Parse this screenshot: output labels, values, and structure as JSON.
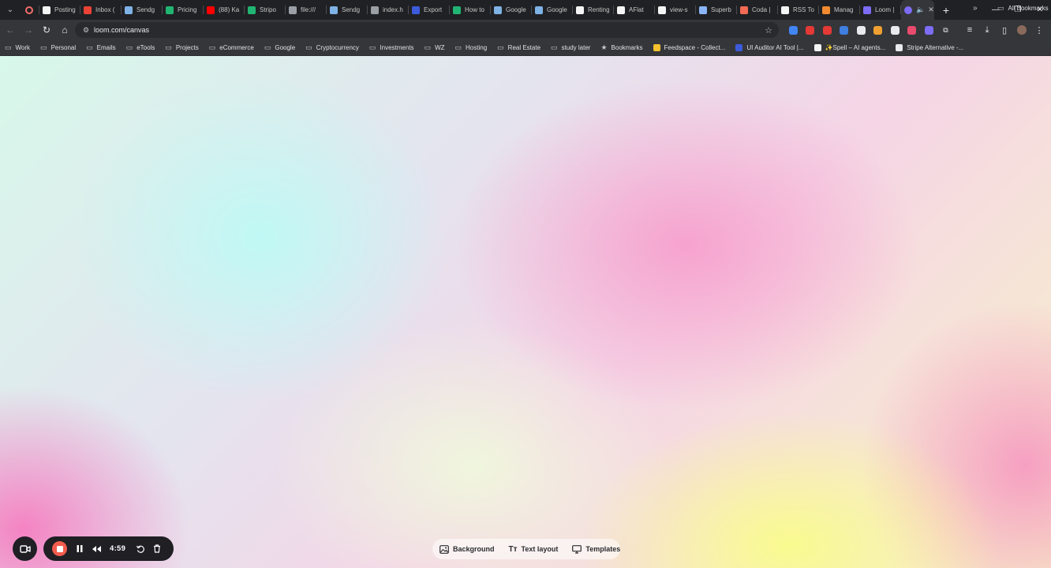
{
  "browser": {
    "tabs": [
      {
        "label": "",
        "color": "#f36b6b",
        "kind": "rec"
      },
      {
        "label": "Posting",
        "color": "#f5f5f5"
      },
      {
        "label": "Inbox (",
        "color": "#ea4335"
      },
      {
        "label": "Sendg",
        "color": "#7fb2e5"
      },
      {
        "label": "Pricing",
        "color": "#21b573"
      },
      {
        "label": "(88) Ka",
        "color": "#ff0000"
      },
      {
        "label": "Stripo",
        "color": "#21b573"
      },
      {
        "label": "file:///",
        "color": "#9aa0a6"
      },
      {
        "label": "Sendg",
        "color": "#7fb2e5"
      },
      {
        "label": "index.h",
        "color": "#9aa0a6"
      },
      {
        "label": "Export",
        "color": "#3b5bdb"
      },
      {
        "label": "How to",
        "color": "#21b573"
      },
      {
        "label": "Google",
        "color": "#7fb2e5"
      },
      {
        "label": "Google",
        "color": "#7fb2e5"
      },
      {
        "label": "Renting",
        "color": "#f5f5f5"
      },
      {
        "label": "AFlat",
        "color": "#f5f5f5"
      },
      {
        "label": "view-s",
        "color": "#f5f5f5"
      },
      {
        "label": "Superb",
        "color": "#8ab4f8"
      },
      {
        "label": "Coda |",
        "color": "#f46a54"
      },
      {
        "label": "RSS To",
        "color": "#f5f5f5"
      },
      {
        "label": "Manag",
        "color": "#f28b30"
      },
      {
        "label": "Loom |",
        "color": "#7c6cf6"
      }
    ],
    "active_tab": {
      "color": "#7c6cf6"
    },
    "new_tab_label": "+",
    "address": {
      "url": "loom.com/canvas"
    },
    "extensions": [
      {
        "name": "extension-1-icon",
        "color": "#4285f4"
      },
      {
        "name": "abp-icon",
        "color": "#e53935"
      },
      {
        "name": "extension-3-icon",
        "color": "#e53935"
      },
      {
        "name": "extension-4-icon",
        "color": "#3f7fe0"
      },
      {
        "name": "extension-5-icon",
        "color": "#e8eaed"
      },
      {
        "name": "extension-6-icon",
        "color": "#f0a030"
      },
      {
        "name": "extension-7-icon",
        "color": "#e8eaed"
      },
      {
        "name": "extension-8-icon",
        "color": "#e84b6b"
      },
      {
        "name": "extension-9-icon",
        "color": "#7c6cf6"
      }
    ],
    "bookmarks": [
      {
        "label": "Work",
        "icon": "folder-icon"
      },
      {
        "label": "Personal",
        "icon": "folder-icon"
      },
      {
        "label": "Emails",
        "icon": "folder-icon"
      },
      {
        "label": "eTools",
        "icon": "folder-icon"
      },
      {
        "label": "Projects",
        "icon": "folder-icon"
      },
      {
        "label": "eCommerce",
        "icon": "folder-icon"
      },
      {
        "label": "Google",
        "icon": "folder-icon"
      },
      {
        "label": "Cryptocurrency",
        "icon": "folder-icon"
      },
      {
        "label": "Investments",
        "icon": "folder-icon"
      },
      {
        "label": "WZ",
        "icon": "folder-icon"
      },
      {
        "label": "Hosting",
        "icon": "folder-icon"
      },
      {
        "label": "Real Estate",
        "icon": "folder-icon"
      },
      {
        "label": "study later",
        "icon": "folder-icon"
      },
      {
        "label": "Bookmarks",
        "icon": "star-icon"
      },
      {
        "label": "Feedspace - Collect...",
        "icon": "favicon",
        "color": "#f5c12e"
      },
      {
        "label": "UI Auditor AI Tool |...",
        "icon": "favicon",
        "color": "#3b5bdb"
      },
      {
        "label": "✨Spell – AI agents...",
        "icon": "favicon",
        "color": "#f5f5f5"
      },
      {
        "label": "Stripe Alternative -...",
        "icon": "favicon",
        "color": "#e8eaed"
      }
    ],
    "all_bookmarks_label": "All Bookmarks"
  },
  "recorder": {
    "timer": "4:59"
  },
  "canvas_toolbar": {
    "background_label": "Background",
    "text_layout_label": "Text layout",
    "templates_label": "Templates"
  }
}
